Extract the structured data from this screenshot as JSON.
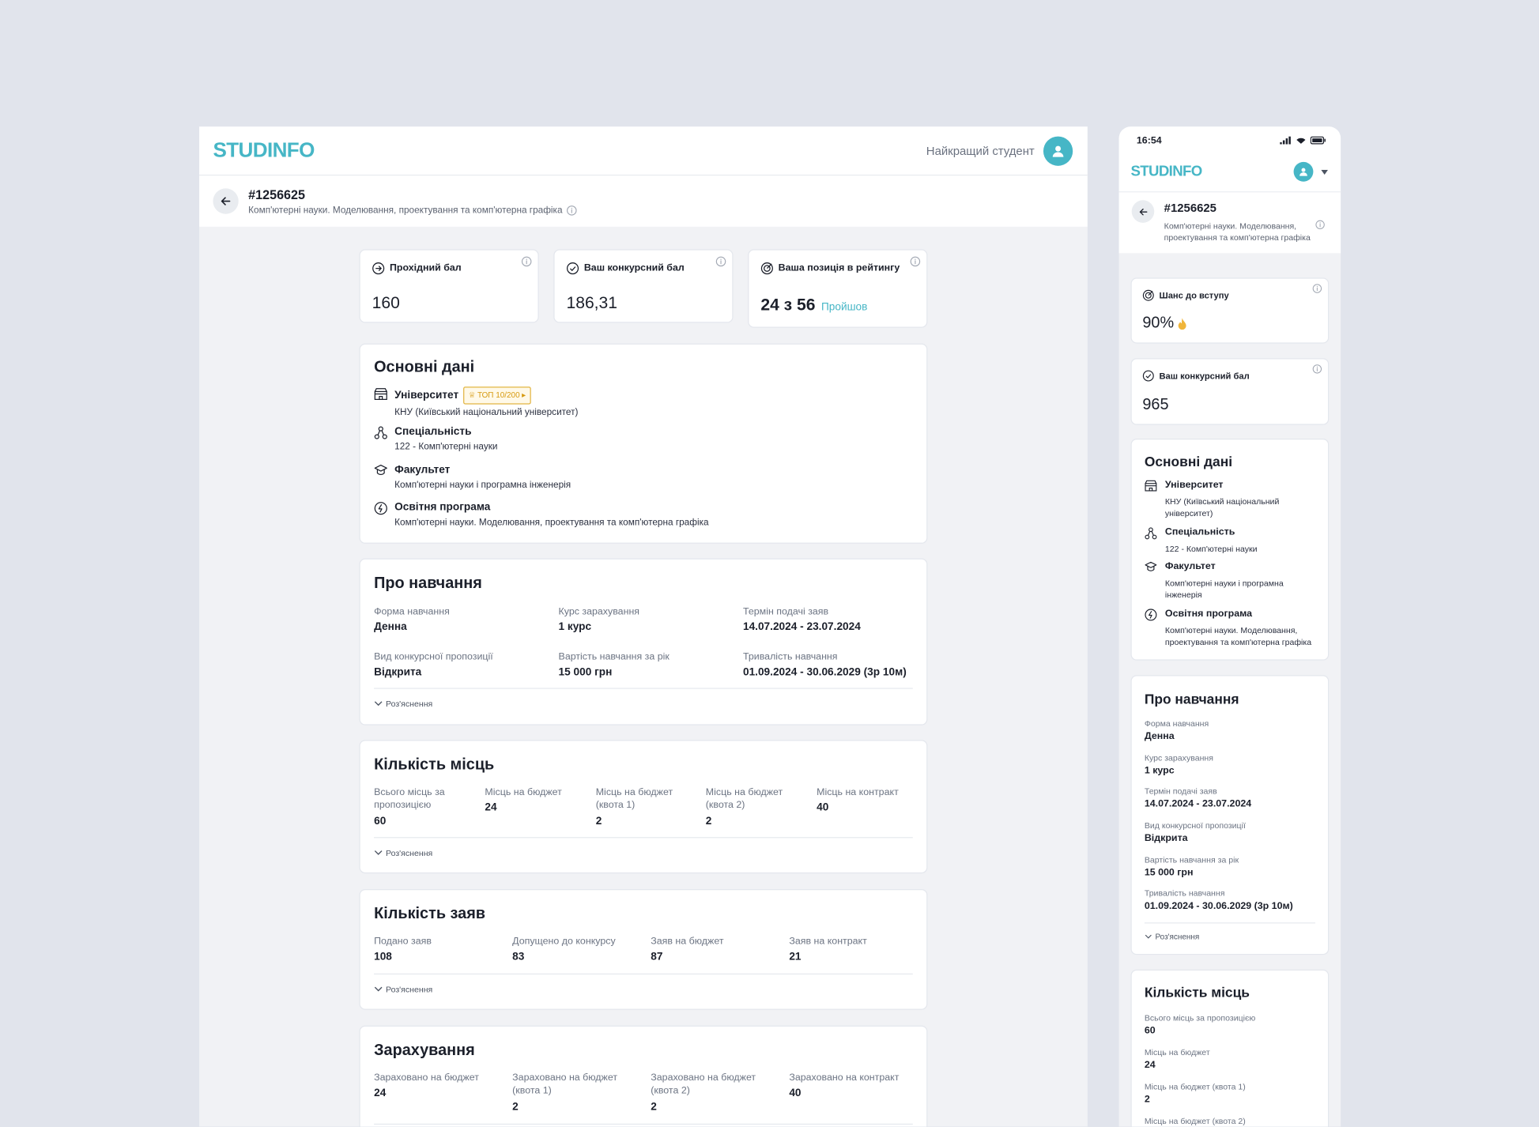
{
  "brand": "STUDINFO",
  "desktop": {
    "user_name": "Найкращий студент",
    "offer_id": "#1256625",
    "offer_subtitle": "Комп'ютерні науки. Моделювання, проектування та комп'ютерна графіка",
    "stats": [
      {
        "label": "Прохідний бал",
        "value": "160",
        "icon": "arrow-circle-icon"
      },
      {
        "label": "Ваш конкурсний бал",
        "value": "186,31",
        "icon": "check-circle-icon"
      },
      {
        "label": "Ваша позиція в рейтингу",
        "value": "24 з 56",
        "status": "Пройшов",
        "icon": "target-icon"
      }
    ],
    "basic": {
      "title": "Основні дані",
      "badge": "ТОП 10/200",
      "items": [
        {
          "label": "Університет",
          "value": "КНУ (Київський національний університет)"
        },
        {
          "label": "Спеціальність",
          "value": "122 - Комп'ютерні науки"
        },
        {
          "label": "Факультет",
          "value": "Комп'ютерні науки і програмна інженерія"
        },
        {
          "label": "Освітня програма",
          "value": "Комп'ютерні науки. Моделювання, проектування та комп'ютерна графіка"
        }
      ]
    },
    "study": {
      "title": "Про навчання",
      "fields": [
        {
          "label": "Форма навчання",
          "value": "Денна"
        },
        {
          "label": "Курс зарахування",
          "value": "1 курс"
        },
        {
          "label": "Термін подачі заяв",
          "value": "14.07.2024 - 23.07.2024"
        },
        {
          "label": "Вид конкурсної пропозиції",
          "value": "Відкрита"
        },
        {
          "label": "Вартість навчання за рік",
          "value": "15 000 грн"
        },
        {
          "label": "Тривалість навчання",
          "value": "01.09.2024 - 30.06.2029 (3р 10м)"
        }
      ],
      "explain": "Роз'яснення"
    },
    "places": {
      "title": "Кількість місць",
      "fields": [
        {
          "label": "Всього місць за пропозицією",
          "value": "60"
        },
        {
          "label": "Місць на бюджет",
          "value": "24"
        },
        {
          "label": "Місць на бюджет (квота 1)",
          "value": "2"
        },
        {
          "label": "Місць на бюджет (квота 2)",
          "value": "2"
        },
        {
          "label": "Місць на контракт",
          "value": "40"
        }
      ],
      "explain": "Роз'яснення"
    },
    "apps": {
      "title": "Кількість заяв",
      "fields": [
        {
          "label": "Подано заяв",
          "value": "108"
        },
        {
          "label": "Допущено до конкурсу",
          "value": "83"
        },
        {
          "label": "Заяв на бюджет",
          "value": "87"
        },
        {
          "label": "Заяв на контракт",
          "value": "21"
        }
      ],
      "explain": "Роз'яснення"
    },
    "enroll": {
      "title": "Зарахування",
      "fields": [
        {
          "label": "Зараховано на бюджет",
          "value": "24"
        },
        {
          "label": "Зараховано на бюджет (квота 1)",
          "value": "2"
        },
        {
          "label": "Зараховано на бюджет (квота 2)",
          "value": "2"
        },
        {
          "label": "Зараховано на контракт",
          "value": "40"
        }
      ]
    }
  },
  "mobile": {
    "time": "16:54",
    "offer_id": "#1256625",
    "offer_subtitle": "Комп'ютерні науки. Моделювання, проектування та комп'ютерна графіка",
    "chance": {
      "label": "Шанс до вступу",
      "value": "90%"
    },
    "score": {
      "label": "Ваш конкурсний бал",
      "value": "965"
    },
    "basic": {
      "title": "Основні дані",
      "items": [
        {
          "label": "Університет",
          "value": "КНУ (Київський національний університет)"
        },
        {
          "label": "Спеціальність",
          "value": "122 - Комп'ютерні науки"
        },
        {
          "label": "Факультет",
          "value": "Комп'ютерні науки і програмна інженерія"
        },
        {
          "label": "Освітня програма",
          "value": "Комп'ютерні науки. Моделювання, проектування та комп'ютерна графіка"
        }
      ]
    },
    "study": {
      "title": "Про навчання",
      "fields": [
        {
          "label": "Форма навчання",
          "value": "Денна"
        },
        {
          "label": "Курс зарахування",
          "value": "1 курс"
        },
        {
          "label": "Термін подачі заяв",
          "value": "14.07.2024 - 23.07.2024"
        },
        {
          "label": "Вид конкурсної пропозиції",
          "value": "Відкрита"
        },
        {
          "label": "Вартість навчання за рік",
          "value": "15 000 грн"
        },
        {
          "label": "Тривалість навчання",
          "value": "01.09.2024 - 30.06.2029 (3р 10м)"
        }
      ],
      "explain": "Роз'яснення"
    },
    "places": {
      "title": "Кількість місць",
      "fields": [
        {
          "label": "Всього місць за пропозицією",
          "value": "60"
        },
        {
          "label": "Місць на бюджет",
          "value": "24"
        },
        {
          "label": "Місць на бюджет (квота 1)",
          "value": "2"
        },
        {
          "label": "Місць на бюджет (квота 2)",
          "value": ""
        }
      ]
    }
  },
  "colors": {
    "brand": "#46b6c6",
    "background": "#e1e4ec",
    "accent_gold": "#e2b542"
  }
}
